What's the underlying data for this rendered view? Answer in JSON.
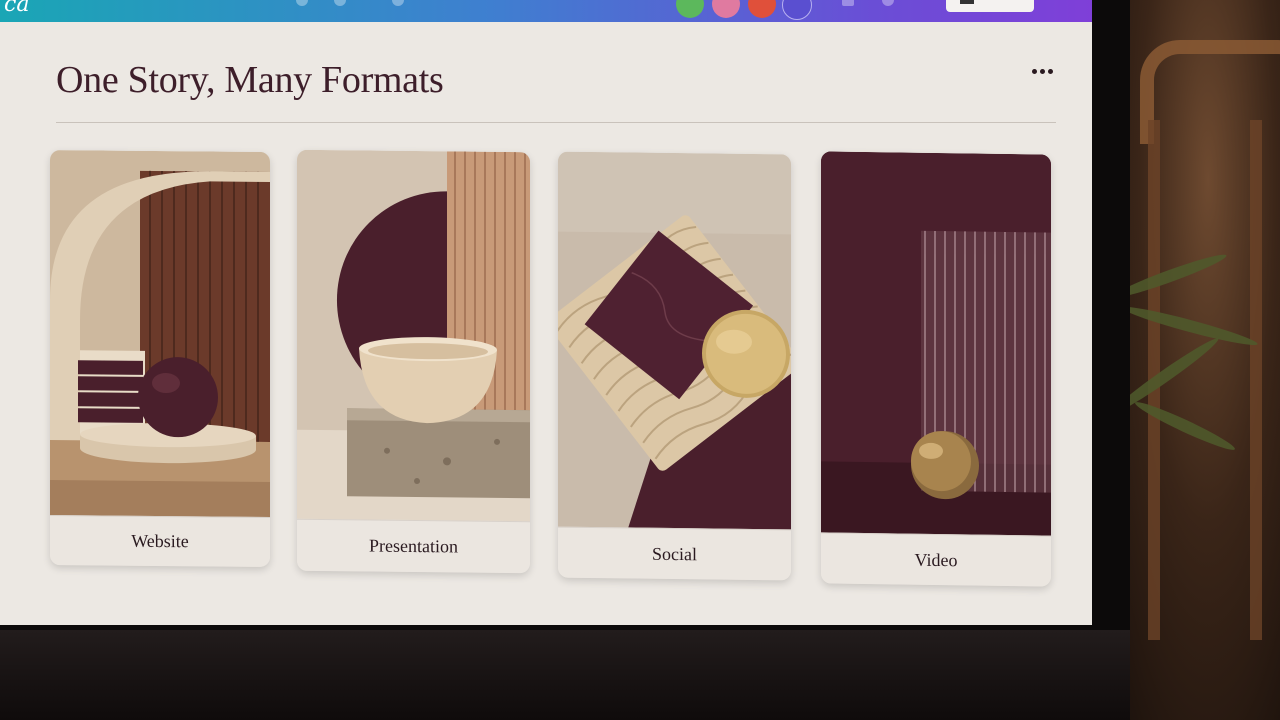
{
  "page": {
    "title": "One Story, Many Formats",
    "more_icon": "more-horizontal-icon"
  },
  "cards": [
    {
      "label": "Website"
    },
    {
      "label": "Presentation"
    },
    {
      "label": "Social"
    },
    {
      "label": "Video"
    }
  ],
  "colors": {
    "title": "#3d1e2a",
    "plum": "#4a1f2c",
    "sand": "#d9c6ab",
    "screen_bg": "#ece8e3"
  }
}
